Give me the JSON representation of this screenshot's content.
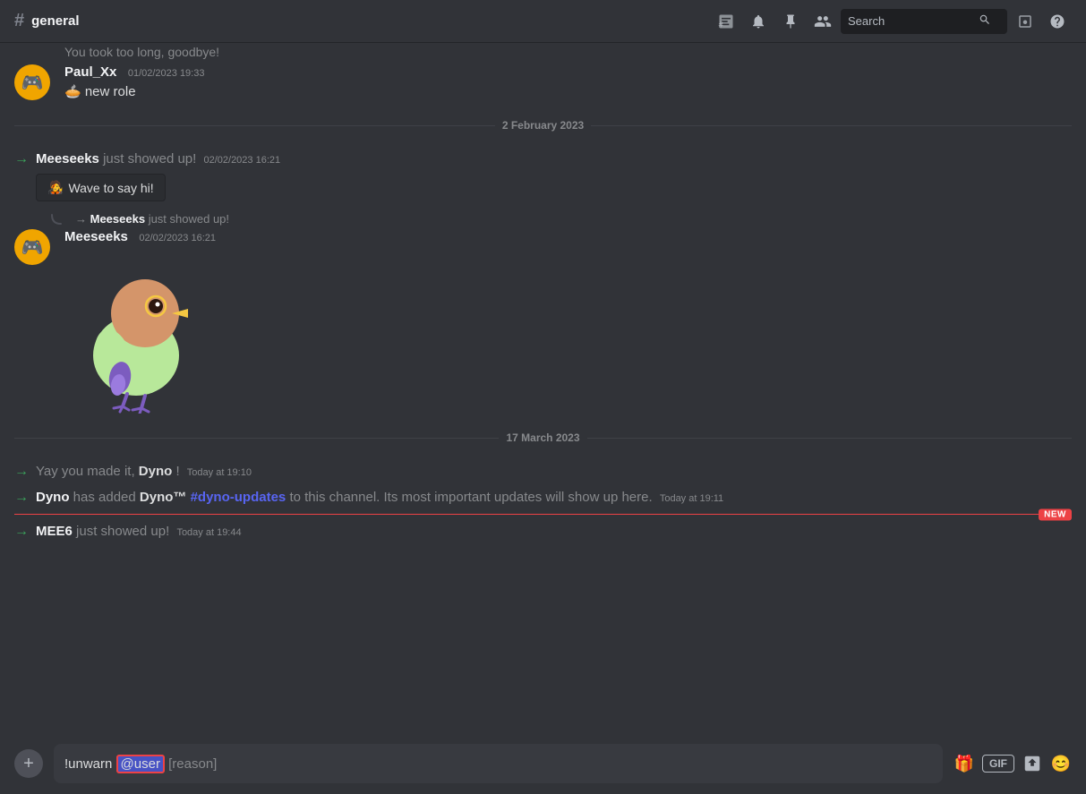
{
  "header": {
    "channel_name": "general",
    "hash": "#",
    "search_placeholder": "Search"
  },
  "messages": {
    "partial_top": "You took too long, goodbye!",
    "paul": {
      "username": "Paul_Xx",
      "timestamp": "01/02/2023 19:33",
      "content": "🥧 new role"
    },
    "divider1": "2 February 2023",
    "meeseeks_system1": {
      "username": "Meeseeks",
      "text_after": " just showed up!",
      "timestamp": "02/02/2023 16:21",
      "wave_button": "Wave to say hi!"
    },
    "meeseeks_reply_indicator": "→ Meeseeks just showed up!",
    "meeseeks_main": {
      "username": "Meeseeks",
      "timestamp": "02/02/2023 16:21"
    },
    "divider2": "17 March 2023",
    "system_dyno1": {
      "text_before": "Yay you made it, ",
      "username": "Dyno",
      "text_after": "!",
      "timestamp": "Today at 19:10"
    },
    "system_dyno2": {
      "username": "Dyno",
      "text1": " has added ",
      "bot_name": "Dyno™",
      "channel": "#dyno-updates",
      "text2": " to this channel. Its most important updates will show up here.",
      "timestamp": "Today at 19:11"
    },
    "new_badge": "NEW",
    "system_mee6": {
      "username": "MEE6",
      "text_after": " just showed up!",
      "timestamp": "Today at 19:44"
    }
  },
  "input": {
    "command": "!unwarn",
    "user": "@user",
    "reason": "[reason]",
    "plus_icon": "+",
    "gift_icon": "🎁",
    "gif_label": "GIF",
    "upload_icon": "📄",
    "emoji_icon": "😊"
  }
}
